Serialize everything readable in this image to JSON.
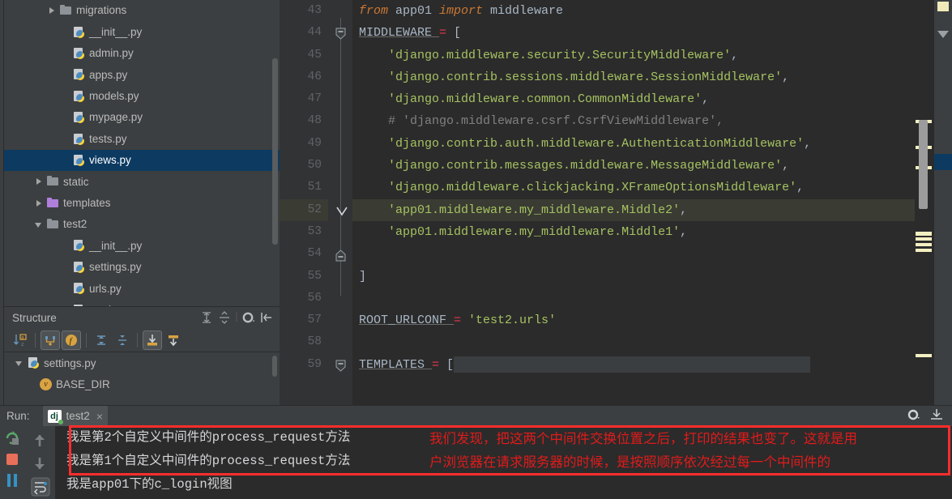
{
  "project_tree": {
    "items": [
      {
        "label": "migrations",
        "icon": "folder-icon",
        "indent": 3,
        "twisty": "closed",
        "type": "folder",
        "selected": false
      },
      {
        "label": "__init__.py",
        "icon": "python-file-icon",
        "indent": 4,
        "twisty": "none",
        "type": "py",
        "selected": false
      },
      {
        "label": "admin.py",
        "icon": "python-file-icon",
        "indent": 4,
        "twisty": "none",
        "type": "py",
        "selected": false
      },
      {
        "label": "apps.py",
        "icon": "python-file-icon",
        "indent": 4,
        "twisty": "none",
        "type": "py",
        "selected": false
      },
      {
        "label": "models.py",
        "icon": "python-file-icon",
        "indent": 4,
        "twisty": "none",
        "type": "py",
        "selected": false
      },
      {
        "label": "mypage.py",
        "icon": "python-file-icon",
        "indent": 4,
        "twisty": "none",
        "type": "py",
        "selected": false
      },
      {
        "label": "tests.py",
        "icon": "python-file-icon",
        "indent": 4,
        "twisty": "none",
        "type": "py",
        "selected": false
      },
      {
        "label": "views.py",
        "icon": "python-file-icon",
        "indent": 4,
        "twisty": "none",
        "type": "py",
        "selected": true
      },
      {
        "label": "static",
        "icon": "folder-icon",
        "indent": 2,
        "twisty": "closed",
        "type": "folder",
        "selected": false
      },
      {
        "label": "templates",
        "icon": "folder-icon-purple",
        "indent": 2,
        "twisty": "closed",
        "type": "folder-purple",
        "selected": false
      },
      {
        "label": "test2",
        "icon": "folder-icon",
        "indent": 2,
        "twisty": "open",
        "type": "folder",
        "selected": false
      },
      {
        "label": "__init__.py",
        "icon": "python-file-icon",
        "indent": 4,
        "twisty": "none",
        "type": "py",
        "selected": false
      },
      {
        "label": "settings.py",
        "icon": "python-file-icon",
        "indent": 4,
        "twisty": "none",
        "type": "py",
        "selected": false
      },
      {
        "label": "urls.py",
        "icon": "python-file-icon",
        "indent": 4,
        "twisty": "none",
        "type": "py",
        "selected": false
      },
      {
        "label": "wsgi.py",
        "icon": "python-file-icon",
        "indent": 4,
        "twisty": "none",
        "type": "py",
        "selected": false
      }
    ]
  },
  "structure": {
    "title": "Structure",
    "header_icons": [
      "expand-all-icon",
      "collapse-all-icon",
      "gear-icon",
      "hide-icon"
    ],
    "toolbar_icons": [
      "sort-alphabetically-icon",
      "show-inherited-icon",
      "show-fields-icon",
      "expand-all-icon",
      "collapse-all-icon",
      "scroll-from-source-icon",
      "scroll-to-source-icon"
    ],
    "items": [
      {
        "label": "settings.py",
        "icon": "python-file-icon",
        "indent": 1,
        "twisty": "open",
        "badge": ""
      },
      {
        "label": "BASE_DIR",
        "icon": "variable-icon",
        "indent": 2,
        "twisty": "none",
        "badge": "v"
      }
    ]
  },
  "editor": {
    "first_line_number": 43,
    "highlighted_line": 52,
    "lines": [
      {
        "n": 43,
        "tokens": [
          {
            "t": "from ",
            "c": "kw"
          },
          {
            "t": "app01 ",
            "c": "plain"
          },
          {
            "t": "import ",
            "c": "kw"
          },
          {
            "t": "middleware",
            "c": "plain"
          }
        ],
        "indent": 0
      },
      {
        "n": 44,
        "tokens": [
          {
            "t": "MIDDLEWARE ",
            "c": "plain-ul"
          },
          {
            "t": "= ",
            "c": "op"
          },
          {
            "t": "[",
            "c": "plain"
          }
        ],
        "indent": 0
      },
      {
        "n": 45,
        "tokens": [
          {
            "t": "'django.middleware.security.SecurityMiddleware'",
            "c": "str"
          },
          {
            "t": ",",
            "c": "plain"
          }
        ],
        "indent": 1
      },
      {
        "n": 46,
        "tokens": [
          {
            "t": "'django.contrib.sessions.middleware.SessionMiddleware'",
            "c": "str"
          },
          {
            "t": ",",
            "c": "plain"
          }
        ],
        "indent": 1
      },
      {
        "n": 47,
        "tokens": [
          {
            "t": "'django.middleware.common.CommonMiddleware'",
            "c": "str"
          },
          {
            "t": ",",
            "c": "plain"
          }
        ],
        "indent": 1
      },
      {
        "n": 48,
        "tokens": [
          {
            "t": "# 'django.middleware.csrf.CsrfViewMiddleware',",
            "c": "cmt"
          }
        ],
        "indent": 1
      },
      {
        "n": 49,
        "tokens": [
          {
            "t": "'django.contrib.auth.middleware.AuthenticationMiddleware'",
            "c": "str"
          },
          {
            "t": ",",
            "c": "plain"
          }
        ],
        "indent": 1
      },
      {
        "n": 50,
        "tokens": [
          {
            "t": "'django.contrib.messages.middleware.MessageMiddleware'",
            "c": "str"
          },
          {
            "t": ",",
            "c": "plain"
          }
        ],
        "indent": 1
      },
      {
        "n": 51,
        "tokens": [
          {
            "t": "'django.middleware.clickjacking.XFrameOptionsMiddleware'",
            "c": "str"
          },
          {
            "t": ",",
            "c": "plain"
          }
        ],
        "indent": 1
      },
      {
        "n": 52,
        "tokens": [
          {
            "t": "'app01.middleware.my_middleware.Middle2'",
            "c": "str"
          },
          {
            "t": ",",
            "c": "plain"
          }
        ],
        "indent": 1
      },
      {
        "n": 53,
        "tokens": [
          {
            "t": "'app01.middleware.my_middleware.Middle1'",
            "c": "str"
          },
          {
            "t": ",",
            "c": "plain"
          }
        ],
        "indent": 1
      },
      {
        "n": 54,
        "tokens": [],
        "indent": 0
      },
      {
        "n": 55,
        "tokens": [
          {
            "t": "]",
            "c": "plain"
          }
        ],
        "indent": 0
      },
      {
        "n": 56,
        "tokens": [],
        "indent": 0
      },
      {
        "n": 57,
        "tokens": [
          {
            "t": "ROOT_URLCONF ",
            "c": "plain-ul"
          },
          {
            "t": "= ",
            "c": "op"
          },
          {
            "t": "'test2.urls'",
            "c": "str"
          }
        ],
        "indent": 0
      },
      {
        "n": 58,
        "tokens": [],
        "indent": 0
      },
      {
        "n": 59,
        "tokens": [
          {
            "t": "TEMPLATES ",
            "c": "plain-ul"
          },
          {
            "t": "= ",
            "c": "op"
          },
          {
            "t": "[",
            "c": "plain"
          }
        ],
        "indent": 0
      }
    ]
  },
  "run_panel": {
    "label": "Run:",
    "tab_name": "test2",
    "tab_icon": "django-icon",
    "close_icon": "close-icon",
    "header_right_icons": [
      "gear-icon",
      "hide-icon"
    ],
    "toolbar_icons": [
      "rerun-icon",
      "stop-icon",
      "pause-icon"
    ],
    "toolbar2_icons": [
      "up-arrow-icon",
      "down-arrow-icon",
      "soft-wrap-icon"
    ],
    "console_lines": [
      "我是第2个自定义中间件的process_request方法",
      "我是第1个自定义中间件的process_request方法",
      "我是app01下的c_login视图"
    ]
  },
  "annotation": {
    "color": "#e01b1b",
    "border_color": "#ff2d2d",
    "lines": [
      "我们发现，把这两个中间件交换位置之后，打印的结果也变了。这就是用",
      "户浏览器在请求服务器的时候，是按照顺序依次经过每一个中间件的"
    ]
  }
}
